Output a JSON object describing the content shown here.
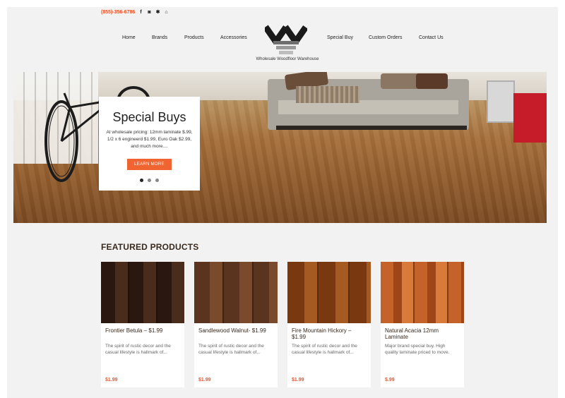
{
  "topbar": {
    "phone": "(855)-356-6786",
    "social_icons": [
      {
        "name": "facebook-icon",
        "glyph": "f"
      },
      {
        "name": "instagram-icon",
        "glyph": "◙"
      },
      {
        "name": "yelp-icon",
        "glyph": "✱"
      },
      {
        "name": "houzz-icon",
        "glyph": "⌂"
      }
    ]
  },
  "nav": {
    "home": "Home",
    "brands": "Brands",
    "products": "Products",
    "accessories": "Accessories",
    "special_buy": "Special Buy",
    "custom_orders": "Custom Orders",
    "contact_us": "Contact Us"
  },
  "logo": {
    "text": "Wholesale Woodfloor Warehouse"
  },
  "hero": {
    "title": "Special Buys",
    "body": "At wholesale pricing: 12mm laminate $.99, 1/2 x 6 engineerd $1.99, Euro Oak $2.99, and much more....",
    "button": "LEARN MORE",
    "slide_count": 3,
    "active_slide": 1
  },
  "featured": {
    "title": "FEATURED PRODUCTS",
    "products": [
      {
        "name": "Frontier Betula – $1.99",
        "desc": "The spirit of rustic decor and the casual lifestyle is hallmark of...",
        "price": "$1.99",
        "swatch": "#3a2318"
      },
      {
        "name": "Sandlewood Walnut- $1.99",
        "desc": "The spirit of rustic decor and the casual lifestyle is hallmark of...",
        "price": "$1.99",
        "swatch": "#6b3f25"
      },
      {
        "name": "Fire Mountain Hickory – $1.99",
        "desc": "The spirit of rustic decor and the casual lifestyle is hallmark of...",
        "price": "$1.99",
        "swatch": "#8a4419"
      },
      {
        "name": "Natural Acacia 12mm Laminate",
        "desc": "Major brand special buy.  High quality laminate priced to move.",
        "price": "$.99",
        "swatch": "#b85a22"
      }
    ]
  },
  "colors": {
    "accent": "#e8552a",
    "button": "#f06431",
    "heading": "#3a2a1e"
  }
}
